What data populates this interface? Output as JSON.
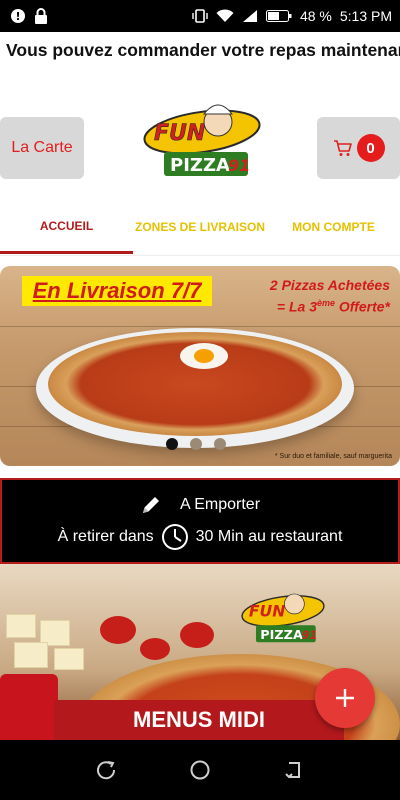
{
  "status_bar": {
    "battery": "48 %",
    "time": "5:13 PM"
  },
  "notice_title": "Vous pouvez commander votre repas maintenant",
  "header": {
    "carte_label": "La Carte",
    "cart_count": "0"
  },
  "logo": {
    "top_text": "FUN",
    "bottom_text": "PIZZA",
    "number": "91"
  },
  "tabs": [
    {
      "label": "ACCUEIL",
      "active": true
    },
    {
      "label": "ZONES DE LIVRAISON",
      "active": false
    },
    {
      "label": "MON COMPTE",
      "active": false
    }
  ],
  "banner": {
    "title": "En Livraison 7/7",
    "promo_line1": "2 Pizzas Achetées",
    "promo_line2_prefix": "= La 3",
    "promo_line2_sup": "ème",
    "promo_line2_suffix": " Offerte*",
    "disclaimer": "* Sur duo et familiale, sauf marguerita",
    "slide_count": 3,
    "active_slide": 1
  },
  "pickup": {
    "mode": "A Emporter",
    "prefix": "À retirer dans",
    "suffix": "30 Min au restaurant"
  },
  "menu_card": {
    "label": "MENUS MIDI"
  },
  "colors": {
    "brand_red": "#b3191c",
    "tab_inactive": "#e5c100",
    "fab": "#e53935"
  }
}
